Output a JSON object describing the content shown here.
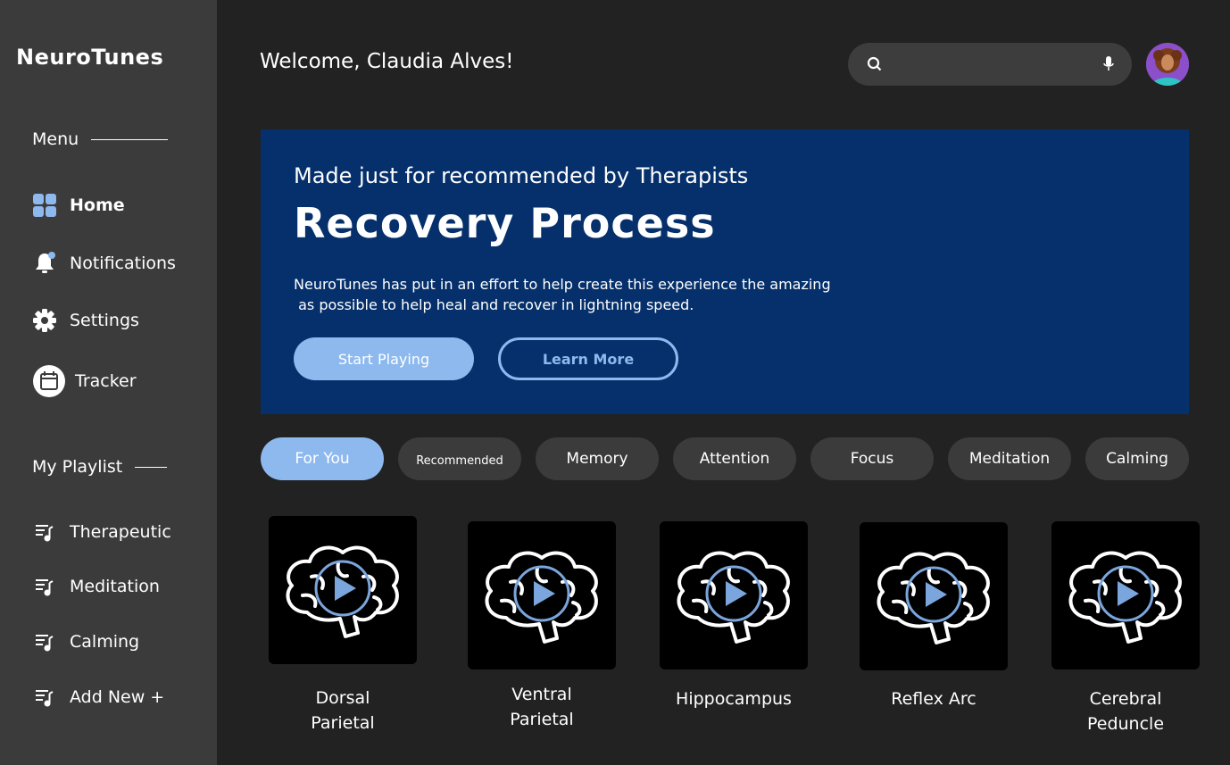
{
  "app": {
    "name": "NeuroTunes"
  },
  "sidebar": {
    "menu_title": "Menu",
    "menu_items": [
      {
        "label": "Home",
        "icon": "grid-icon"
      },
      {
        "label": "Notifications",
        "icon": "bell-icon"
      },
      {
        "label": "Settings",
        "icon": "gear-icon"
      },
      {
        "label": "Tracker",
        "icon": "calendar-icon"
      }
    ],
    "playlist_title": "My Playlist",
    "playlist_items": [
      {
        "label": "Therapeutic",
        "icon": "playlist-icon"
      },
      {
        "label": "Meditation",
        "icon": "playlist-icon"
      },
      {
        "label": "Calming",
        "icon": "playlist-icon"
      },
      {
        "label": "Add New +",
        "icon": "playlist-icon"
      }
    ]
  },
  "header": {
    "welcome": "Welcome, Claudia Alves!",
    "search_placeholder": ""
  },
  "hero": {
    "subtitle": "Made just for recommended by Therapists",
    "title": "Recovery Process",
    "description_line1": "NeuroTunes has put in an effort to help create this experience the amazing",
    "description_line2": " as possible to help heal and recover in lightning speed.",
    "primary_button": "Start Playing",
    "secondary_button": "Learn More"
  },
  "filters": [
    {
      "label": "For You",
      "active": true
    },
    {
      "label": "Recommended",
      "active": false
    },
    {
      "label": "Memory",
      "active": false
    },
    {
      "label": "Attention",
      "active": false
    },
    {
      "label": "Focus",
      "active": false
    },
    {
      "label": "Meditation",
      "active": false
    },
    {
      "label": "Calming",
      "active": false
    }
  ],
  "tracks": [
    {
      "line1": "Dorsal",
      "line2": "Parietal"
    },
    {
      "line1": "Ventral",
      "line2": "Parietal"
    },
    {
      "line1": "Hippocampus",
      "line2": ""
    },
    {
      "line1": "Reflex Arc",
      "line2": ""
    },
    {
      "line1": "Cerebral",
      "line2": "Peduncle"
    }
  ],
  "colors": {
    "accent": "#8db9ef",
    "hero_bg": "#06306b",
    "sidebar_bg": "#3b3b3b",
    "page_bg": "#222222"
  }
}
